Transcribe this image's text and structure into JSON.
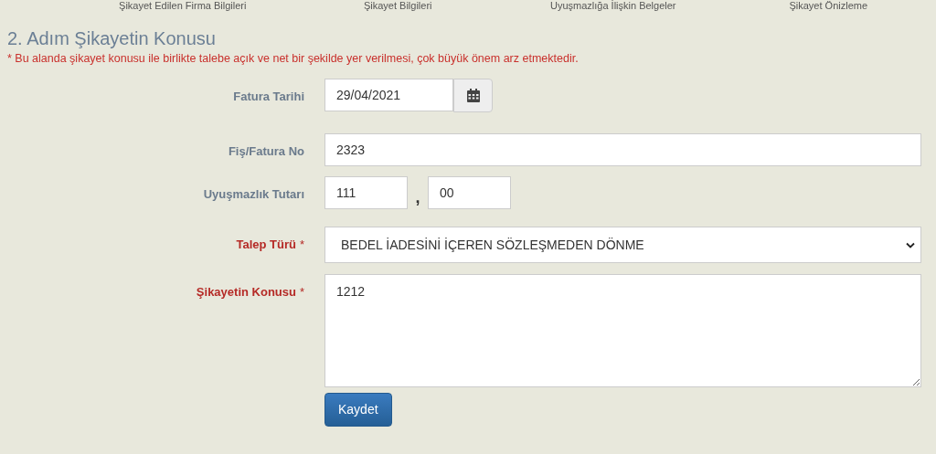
{
  "steps": [
    "Şikayet Edilen Firma Bilgileri",
    "Şikayet Bilgileri",
    "Uyuşmazlığa İlişkin Belgeler",
    "Şikayet Önizleme"
  ],
  "heading": "2. Adım Şikayetin Konusu",
  "notice": "* Bu alanda şikayet konusu ile birlikte talebe açık ve net bir şekilde yer verilmesi, çok büyük önem arz etmektedir.",
  "fields": [
    {
      "kind": "date",
      "label": "Fatura Tarihi",
      "required": false,
      "value": "29/04/2021"
    },
    {
      "kind": "text",
      "label": "Fiş/Fatura No",
      "required": false,
      "value": "2323"
    },
    {
      "kind": "amount",
      "label": "Uyuşmazlık Tutarı",
      "required": false,
      "value": "111",
      "separator": ",",
      "decimals": "00"
    },
    {
      "kind": "select",
      "label": "Talep Türü",
      "required": true,
      "required_mark": "*",
      "value": "BEDEL İADESİNİ İÇEREN SÖZLEŞMEDEN DÖNME"
    },
    {
      "kind": "textarea",
      "label": "Şikayetin Konusu",
      "required": true,
      "required_mark": "*",
      "value": "1212"
    }
  ],
  "submit": "Kaydet"
}
